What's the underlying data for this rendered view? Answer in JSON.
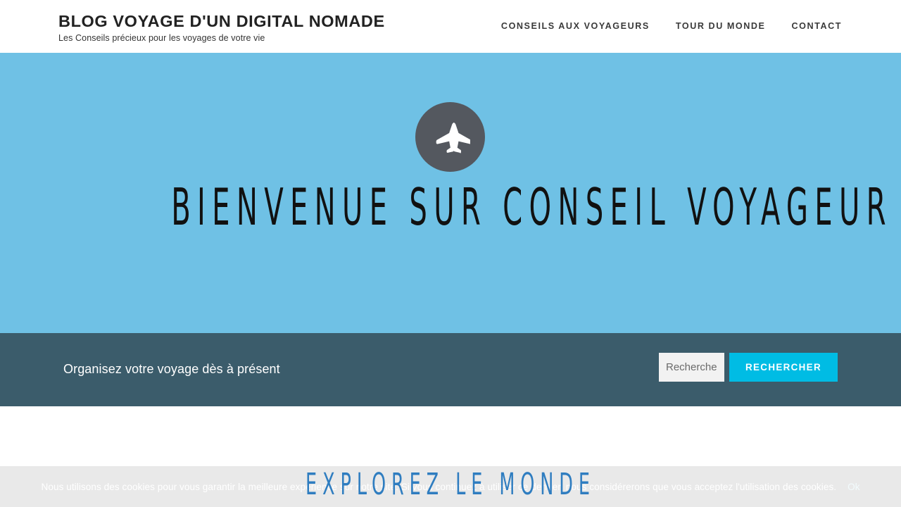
{
  "header": {
    "brand_title": "BLOG VOYAGE D'UN DIGITAL NOMADE",
    "brand_subtitle": "Les Conseils précieux pour les voyages de votre vie",
    "nav": [
      {
        "label": "CONSEILS AUX VOYAGEURS"
      },
      {
        "label": "TOUR DU MONDE"
      },
      {
        "label": "CONTACT"
      }
    ]
  },
  "hero": {
    "icon": "airplane-icon",
    "title": "BIENVENUE SUR CONSEIL VOYAGEUR",
    "background_color": "#6fc1e5",
    "badge_color": "#54585f"
  },
  "search_band": {
    "tagline": "Organisez votre voyage dès à présent",
    "input_placeholder": "Recherche",
    "input_value": "",
    "button_label": "RECHERCHER",
    "background_color": "#3b5c6b",
    "button_color": "#00bce4"
  },
  "section": {
    "title": "EXPLOREZ LE MONDE",
    "title_color": "#2f7dc0"
  },
  "cookie_banner": {
    "message": "Nous utilisons des cookies pour vous garantir la meilleure expérience sur notre site. Si vous continuez à utiliser ce dernier, nous considérerons que vous acceptez l'utilisation des cookies.",
    "accept_label": "Ok",
    "background_color": "#e9e9e9"
  }
}
